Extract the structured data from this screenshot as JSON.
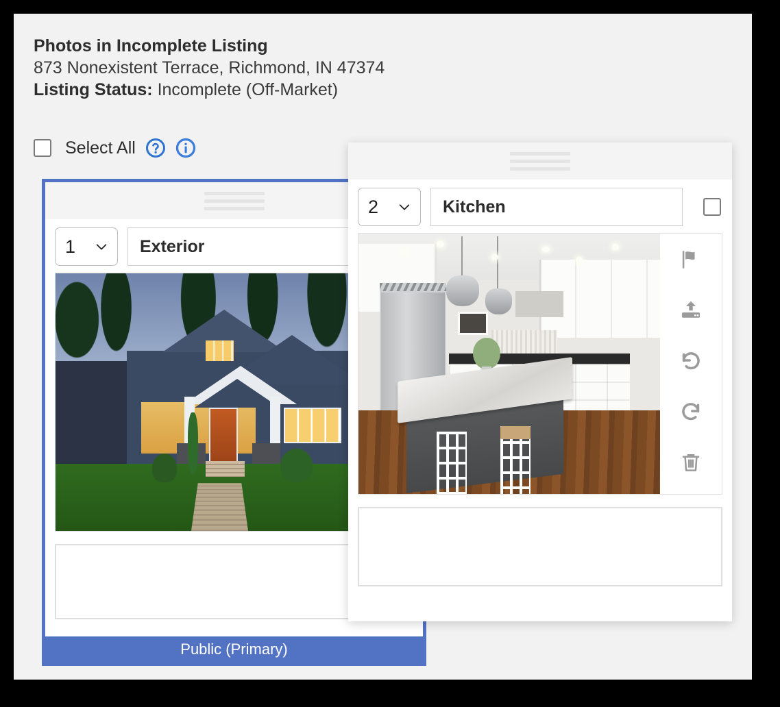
{
  "header": {
    "title": "Photos in Incomplete Listing",
    "address": "873 Nonexistent Terrace, Richmond, IN 47374",
    "status_label": "Listing Status:",
    "status_value": "Incomplete (Off-Market)"
  },
  "toolbar": {
    "select_all_label": "Select All",
    "help_icon": "question-circle-icon",
    "info_icon": "info-circle-icon",
    "icon_color": "#2f74d0"
  },
  "colors": {
    "selection_blue": "#5272c4",
    "page_background": "#f2f2f2",
    "card_background": "#ffffff",
    "frame_black": "#000000",
    "toolbar_icon_gray": "#9b9b9b"
  },
  "cards": [
    {
      "order": "1",
      "caption": "Exterior",
      "description": "",
      "selected": true,
      "checkbox_checked": false,
      "primary_badge": "Public (Primary)",
      "photo_alt": "Blue craftsman house exterior at dusk with lit windows and paver walkway",
      "drag_handle": "drag-handle-icon"
    },
    {
      "order": "2",
      "caption": "Kitchen",
      "description": "",
      "selected": false,
      "checkbox_checked": false,
      "primary_badge": "",
      "photo_alt": "White kitchen with marble island, stainless refrigerator and pendant lights",
      "drag_handle": "drag-handle-icon",
      "actions": [
        {
          "name": "flag-icon",
          "label": "Flag"
        },
        {
          "name": "upload-icon",
          "label": "Upload"
        },
        {
          "name": "rotate-left-icon",
          "label": "Rotate Left"
        },
        {
          "name": "rotate-right-icon",
          "label": "Rotate Right"
        },
        {
          "name": "trash-icon",
          "label": "Delete"
        }
      ]
    }
  ]
}
